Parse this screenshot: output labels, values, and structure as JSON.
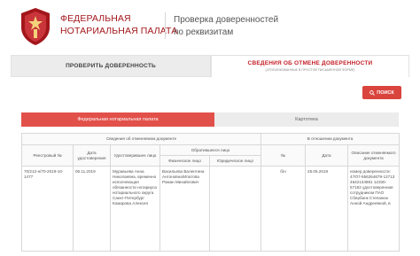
{
  "header": {
    "brand_line1": "ФЕДЕРАЛЬНАЯ",
    "brand_line2": "НОТАРИАЛЬНАЯ ПАЛАТА",
    "subtitle_line1": "Проверка доверенностей",
    "subtitle_line2": "по реквизитам",
    "logo_icon": "fnp-emblem-icon",
    "brand_color": "#a3161b"
  },
  "tabs": {
    "check_label": "ПРОВЕРИТЬ ДОВЕРЕННОСТЬ",
    "cancel_label": "СВЕДЕНИЯ ОБ ОТМЕНЕ ДОВЕРЕННОСТИ",
    "cancel_sublabel": "(ОПУБЛИКОВАННЫЕ В ПРОСТОЙ ПИСЬМЕННОЙ ФОРМЕ)"
  },
  "search": {
    "label": "ПОИСК",
    "icon": "search-icon",
    "color": "#d9443d"
  },
  "subtabs": {
    "active_label": "Федеральная нотариальная палата",
    "inactive_label": "Картотека",
    "active_color": "#e2504a"
  },
  "table": {
    "group_doc": "Сведения об отменяемом документе",
    "group_trust": "В отношении документа",
    "col_reg": "Реестровый №",
    "col_date": "Дата удостоверения",
    "col_certifier": "Удостоверившее лицо",
    "group_applicant": "Обратившееся лицо",
    "col_individual": "Физическое лицо",
    "col_legal": "Юридическое лицо",
    "col_num": "№",
    "col_cancel_date": "Дата",
    "col_desc": "Описание отменяемого документа",
    "rows": [
      {
        "reg": "70/212-н/70-2019-10-1477",
        "date": "06.11.2019",
        "certifier": "Муравьева Анна Николаевна, временно исполняющая обязанности нотариуса нотариального округа Санкт-Петербург Комарова Алексея",
        "individual": "Васильева Валентина Антоновна/Ипатова Роман Михайлович",
        "legal": "",
        "num": "б/н",
        "cancel_date": "25.05.2019",
        "desc": "номер доверенности: 47/07-556264679-12713 4642134881 12330-57182 удостоверенная сотрудником ПАО Сбербанк Степанюк Анной Андреевной, в"
      }
    ]
  }
}
